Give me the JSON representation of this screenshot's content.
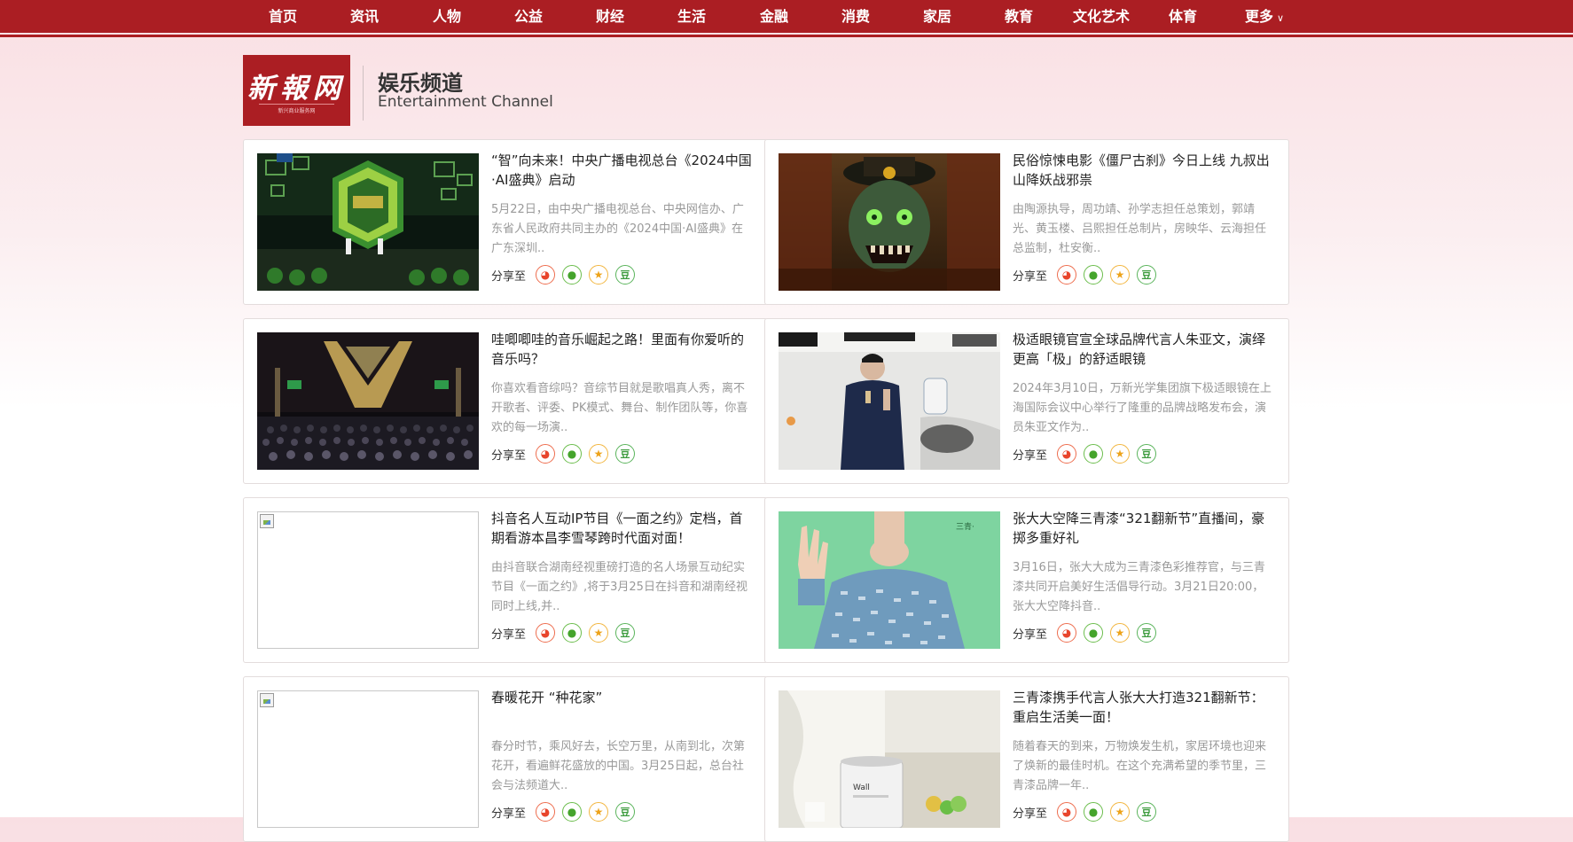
{
  "nav": {
    "items": [
      "首页",
      "资讯",
      "人物",
      "公益",
      "财经",
      "生活",
      "金融",
      "消费",
      "家居",
      "教育",
      "文化艺术",
      "体育"
    ],
    "more": "更多"
  },
  "header": {
    "logo_text": "新報网",
    "logo_sub": "新兴商业服务网",
    "channel_title": "娱乐频道",
    "channel_subtitle": "Entertainment Channel"
  },
  "share_label": "分享至",
  "share_icons": [
    "weibo-icon",
    "wechat-icon",
    "qzone-icon",
    "douban-icon"
  ],
  "colors": {
    "brand": "#ab1e23",
    "desc": "#999999"
  },
  "articles": [
    {
      "title": "“智”向未来！中央广播电视总台《2024中国·AI盛典》启动",
      "desc": "5月22日，由中央广播电视总台、中央网信办、广东省人民政府共同主办的《2024中国·AI盛典》在广东深圳..",
      "thumb": "stage"
    },
    {
      "title": "民俗惊悚电影《僵尸古刹》今日上线 九叔出山降妖战邪祟",
      "desc": "由陶源执导，周功靖、孙学志担任总策划，郭靖光、黄玉楼、吕熙担任总制片，房映华、云海担任总监制，杜安衡..",
      "thumb": "poster"
    },
    {
      "title": "哇唧唧哇的音乐崛起之路！里面有你爱听的音乐吗？",
      "desc": "你喜欢看音综吗？音综节目就是歌唱真人秀，离不开歌者、评委、PK模式、舞台、制作团队等，你喜欢的每一场演..",
      "thumb": "crowd"
    },
    {
      "title": "极适眼镜官宣全球品牌代言人朱亚文，演绎更高「极」的舒适眼镜",
      "desc": "2024年3月10日，万新光学集团旗下极适眼镜在上海国际会议中心举行了隆重的品牌战略发布会，演员朱亚文作为..",
      "thumb": "speaker"
    },
    {
      "title": "抖音名人互动IP节目《一面之约》定档，首期看游本昌李雪琴跨时代面对面！",
      "desc": "由抖音联合湖南经视重磅打造的名人场景互动纪实节目《一面之约》,将于3月25日在抖音和湖南经视同时上线,并..",
      "thumb": "broken"
    },
    {
      "title": "张大大空降三青漆“321翻新节”直播间，豪掷多重好礼",
      "desc": "3月16日，张大大成为三青漆色彩推荐官，与三青漆共同开启美好生活倡导行动。3月21日20:00，张大大空降抖音..",
      "thumb": "sweater"
    },
    {
      "title": "春暖花开 “种花家”",
      "desc": "春分时节，乘风好去，长空万里，从南到北，次第花开，看遍鲜花盛放的中国。3月25日起，总台社会与法频道大..",
      "thumb": "broken"
    },
    {
      "title": "三青漆携手代言人张大大打造321翻新节：重启生活美一面！",
      "desc": "随着春天的到来，万物焕发生机，家居环境也迎来了焕新的最佳时机。在这个充满希望的季节里，三青漆品牌一年..",
      "thumb": "paint"
    }
  ]
}
